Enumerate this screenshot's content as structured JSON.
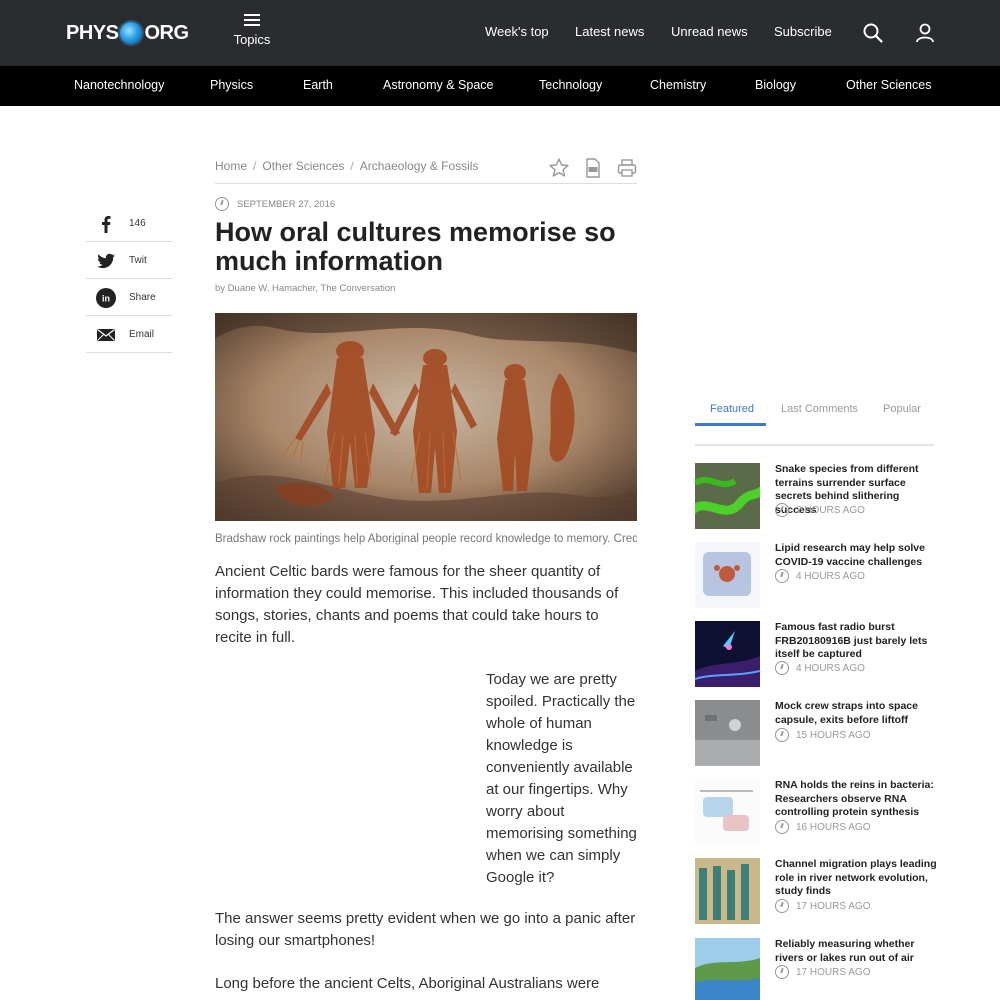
{
  "header": {
    "logo_left": "PHYS",
    "logo_right": "ORG",
    "topics_label": "Topics",
    "nav": [
      "Week's top",
      "Latest news",
      "Unread news",
      "Subscribe"
    ]
  },
  "categories": [
    "Nanotechnology",
    "Physics",
    "Earth",
    "Astronomy & Space",
    "Technology",
    "Chemistry",
    "Biology",
    "Other Sciences"
  ],
  "share": [
    {
      "label": "146",
      "icon": "facebook-icon"
    },
    {
      "label": "Twit",
      "icon": "twitter-icon"
    },
    {
      "label": "Share",
      "icon": "linkedin-icon"
    },
    {
      "label": "Email",
      "icon": "email-icon"
    }
  ],
  "breadcrumb": [
    "Home",
    "Other Sciences",
    "Archaeology & Fossils"
  ],
  "article": {
    "date": "SEPTEMBER 27, 2016",
    "title": "How oral cultures memorise so much information",
    "byline": "by Duane W. Hamacher, The Conversation",
    "caption": "Bradshaw rock paintings help Aboriginal people record knowledge to memory. Credit: Wikimedia Commons",
    "p1": "Ancient Celtic bards were famous for the sheer quantity of information they could memorise. This included thousands of songs, stories, chants and poems that could take hours to recite in full.",
    "p2": "Today we are pretty spoiled. Practically the whole of human knowledge is conveniently available at our fingertips. Why worry about memorising something when we can simply Google it?",
    "p3": "The answer seems pretty evident when we go into a panic after losing our smartphones!",
    "p4": "Long before the ancient Celts, Aboriginal Australians were"
  },
  "sidebar": {
    "tabs": [
      "Featured",
      "Last Comments",
      "Popular"
    ],
    "active_tab": "Featured",
    "items": [
      {
        "headline": "Snake species from different terrains surrender surface secrets behind slithering success",
        "ago": "2 HOURS AGO"
      },
      {
        "headline": "Lipid research may help solve COVID-19 vaccine challenges",
        "ago": "4 HOURS AGO"
      },
      {
        "headline": "Famous fast radio burst FRB20180916B just barely lets itself be captured",
        "ago": "4 HOURS AGO"
      },
      {
        "headline": "Mock crew straps into space capsule, exits before liftoff",
        "ago": "15 HOURS AGO"
      },
      {
        "headline": "RNA holds the reins in bacteria: Researchers observe RNA controlling protein synthesis",
        "ago": "16 HOURS AGO"
      },
      {
        "headline": "Channel migration plays leading role in river network evolution, study finds",
        "ago": "17 HOURS AGO"
      },
      {
        "headline": "Reliably measuring whether rivers or lakes run out of air",
        "ago": "17 HOURS AGO"
      }
    ]
  },
  "colors": {
    "topbar": "#2a2c30",
    "catbar": "#000000",
    "accent": "#3b7ad0"
  }
}
